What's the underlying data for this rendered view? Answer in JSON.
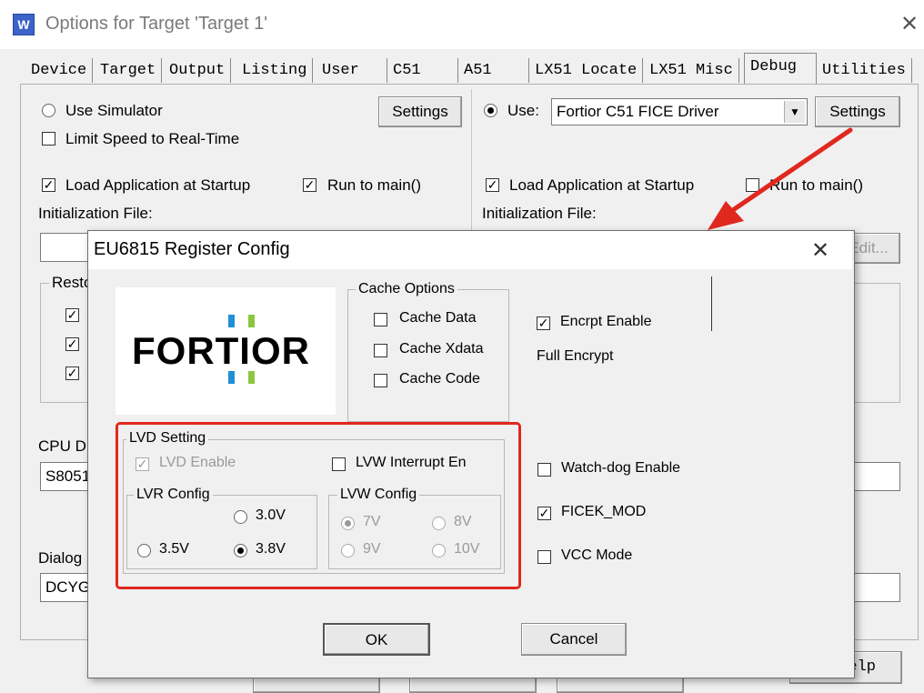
{
  "window": {
    "title": "Options for Target 'Target 1'",
    "close_glyph": "✕",
    "icon_letter": "W"
  },
  "tabs": [
    "Device",
    "Target",
    "Output",
    "Listing",
    "User",
    "C51",
    "A51",
    "LX51 Locate",
    "LX51 Misc",
    "Debug",
    "Utilities"
  ],
  "active_tab": "Debug",
  "left": {
    "use_simulator": "Use Simulator",
    "limit_speed": "Limit Speed to Real-Time",
    "settings": "Settings",
    "load_app": "Load Application at Startup",
    "run_to_main": "Run to main()",
    "init_file": "Initialization File:",
    "restore": "Resto",
    "cpu_dll": "CPU D",
    "cpu_dll_value": "S8051",
    "dialog_dll": "Dialog",
    "dialog_dll_value": "DCYG"
  },
  "right": {
    "use": "Use:",
    "driver": "Fortior C51 FICE Driver",
    "settings": "Settings",
    "load_app": "Load Application at Startup",
    "run_to_main": "Run to main()",
    "init_file": "Initialization File:",
    "edit": "Edit...",
    "help": "Help"
  },
  "dialog": {
    "title": "EU6815 Register Config",
    "close_glyph": "✕",
    "logo_text": "FORTIOR",
    "cache_options": {
      "title": "Cache Options",
      "items": [
        "Cache Data",
        "Cache Xdata",
        "Cache Code"
      ]
    },
    "encrypt_enable": "Encrpt Enable",
    "full_encrypt": "Full Encrypt",
    "lvd": {
      "title": "LVD Setting",
      "lvd_enable": "LVD Enable",
      "lvw_interrupt": "LVW Interrupt En",
      "lvr_title": "LVR Config",
      "lvr_options": [
        "3.0V",
        "3.5V",
        "3.8V"
      ],
      "lvr_selected": "3.8V",
      "lvw_title": "LVW Config",
      "lvw_options": [
        "7V",
        "8V",
        "9V",
        "10V"
      ],
      "lvw_selected": "7V"
    },
    "watchdog": "Watch-dog Enable",
    "ficek_mod": "FICEK_MOD",
    "vcc_mode": "VCC Mode",
    "ok": "OK",
    "cancel": "Cancel"
  },
  "colors": {
    "highlight": "#e0281f",
    "logo_blue": "#1f8fd6",
    "logo_green": "#8cc63f"
  }
}
